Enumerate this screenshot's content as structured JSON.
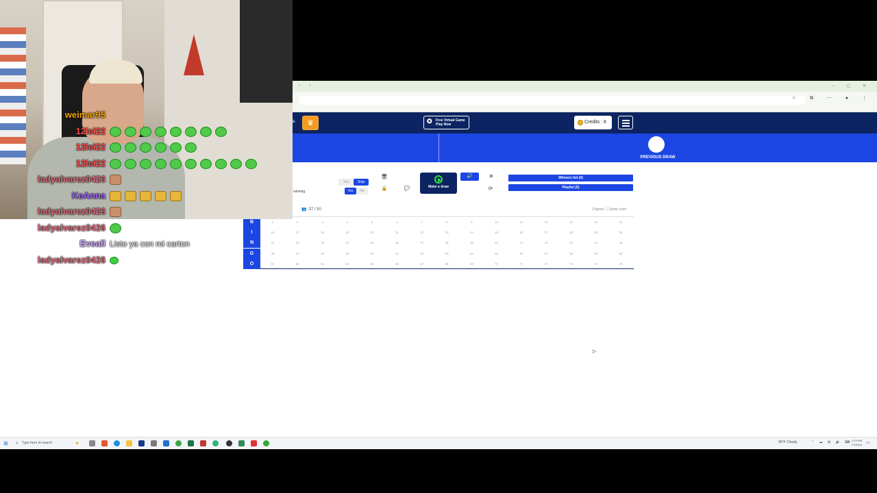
{
  "browser": {
    "nav_glyphs": "‹ ›",
    "window_controls": "– ▢ ✕",
    "toolbar_glyphs": "☆ ⧉ ⋯ ● ⋮"
  },
  "site": {
    "menu_left": "≡",
    "brand_icon": "♛",
    "free_game_label": "Free Virtual Game Play Now",
    "credits_label": "Credits : 8",
    "previous_draw_label": "PREVIOUS DRAW"
  },
  "controls": {
    "winning_label": "e winning",
    "toggle1": [
      "Yes",
      "Stop"
    ],
    "toggle2": [
      "Yes",
      "No"
    ],
    "make_draw_label": "Make a draw",
    "winners_list_label": "Winners list (0)",
    "playlist_label": "Playlist (0)",
    "sound_icon": "🔊",
    "close_icon": "✕",
    "refresh_icon": "⟳",
    "monitor_icon": "🖥",
    "lock_icon": "🔒",
    "chat_icon": "💬"
  },
  "board": {
    "players_count": "37 / 50",
    "meta": "2 lignes   ⓘ Same color",
    "letters": [
      "B",
      "I",
      "N",
      "G",
      "O"
    ],
    "rows": [
      [
        "1",
        "2",
        "3",
        "4",
        "5",
        "6",
        "7",
        "8",
        "9",
        "10",
        "11",
        "12",
        "13",
        "14",
        "15"
      ],
      [
        "16",
        "17",
        "18",
        "19",
        "20",
        "21",
        "22",
        "23",
        "24",
        "25",
        "26",
        "27",
        "28",
        "29",
        "30"
      ],
      [
        "31",
        "32",
        "33",
        "34",
        "35",
        "36",
        "37",
        "38",
        "39",
        "40",
        "41",
        "42",
        "43",
        "44",
        "45"
      ],
      [
        "46",
        "47",
        "48",
        "49",
        "50",
        "51",
        "52",
        "53",
        "54",
        "55",
        "56",
        "57",
        "58",
        "59",
        "60"
      ],
      [
        "61",
        "62",
        "63",
        "64",
        "65",
        "66",
        "67",
        "68",
        "69",
        "70",
        "71",
        "72",
        "73",
        "74",
        "75"
      ]
    ]
  },
  "taskbar": {
    "search_placeholder": "Type here to search",
    "weather": "90°F Cloudy",
    "tray": "⌃ ☁ ⊞ 🔊 ⌨",
    "time": "2:24 PM",
    "date": "7/7/2024"
  },
  "chat": [
    {
      "user": "weimar95",
      "color": "#f2a500",
      "text": "",
      "emotes": 0,
      "kind": ""
    },
    {
      "user": "12lei22",
      "color": "#ff4b4b",
      "text": "",
      "emotes": 8,
      "kind": "frog"
    },
    {
      "user": "12lei22",
      "color": "#ff4b4b",
      "text": "",
      "emotes": 6,
      "kind": "frog"
    },
    {
      "user": "12lei22",
      "color": "#ff4b4b",
      "text": "",
      "emotes": 10,
      "kind": "frog"
    },
    {
      "user": "ladyalvarez0426",
      "color": "#e0697c",
      "text": "",
      "emotes": 1,
      "kind": "face"
    },
    {
      "user": "KeAnna",
      "color": "#9b5cff",
      "text": "",
      "emotes": 5,
      "kind": "gold"
    },
    {
      "user": "ladyalvarez0426",
      "color": "#e0697c",
      "text": "",
      "emotes": 1,
      "kind": "face"
    },
    {
      "user": "ladyalvarez0426",
      "color": "#e0697c",
      "text": "",
      "emotes": 1,
      "kind": "frog"
    },
    {
      "user": "Eveall",
      "color": "#cfa6ff",
      "text": "Listo ya con mi carton",
      "emotes": 0,
      "kind": ""
    },
    {
      "user": "ladyalvarez0426",
      "color": "#e0697c",
      "text": "",
      "emotes": 1,
      "kind": "sm"
    }
  ]
}
